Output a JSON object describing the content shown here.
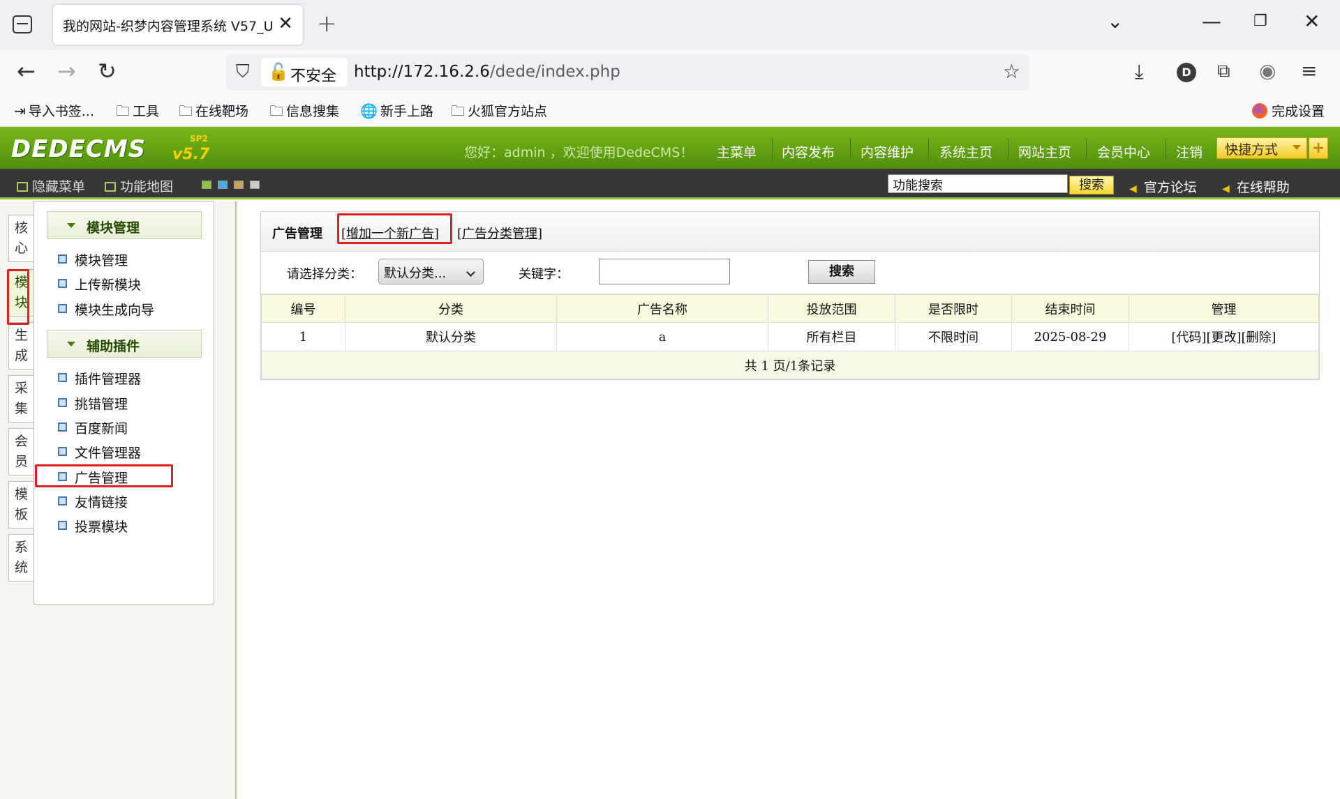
{
  "browser": {
    "tab_title": "我的网站-织梦内容管理系统 V57_U",
    "security_label": "不安全",
    "url_host": "http://172.16.2.6",
    "url_path": "/dede/index.php",
    "profile_initial": "D",
    "bookmarks": [
      "导入书签...",
      "工具",
      "在线靶场",
      "信息搜集",
      "新手上路",
      "火狐官方站点"
    ],
    "setup_label": "完成设置"
  },
  "cms": {
    "logo": "DEDECMS",
    "version": "v5.7",
    "sp": "SP2",
    "welcome": "您好：admin ，欢迎使用DedeCMS！",
    "topnav": [
      "主菜单",
      "内容发布",
      "内容维护",
      "系统主页",
      "网站主页",
      "会员中心",
      "注销"
    ],
    "quick_label": "快捷方式",
    "quick_plus": "+",
    "bar_hide_menu": "隐藏菜单",
    "bar_sitemap": "功能地图",
    "func_search_value": "功能搜索",
    "func_search_btn": "搜索",
    "forum": "官方论坛",
    "help": "在线帮助"
  },
  "side_tabs": [
    "核心",
    "模块",
    "生成",
    "采集",
    "会员",
    "模板",
    "系统"
  ],
  "menu": {
    "group1_title": "模块管理",
    "group1_items": [
      "模块管理",
      "上传新模块",
      "模块生成向导"
    ],
    "group2_title": "辅助插件",
    "group2_items": [
      "插件管理器",
      "挑错管理",
      "百度新闻",
      "文件管理器",
      "广告管理",
      "友情链接",
      "投票模块"
    ]
  },
  "main": {
    "title": "广告管理",
    "link_add": "增加一个新广告",
    "link_category": "广告分类管理",
    "filter_label": "请选择分类：",
    "filter_value": "默认分类...",
    "keyword_label": "关键字：",
    "search_btn": "搜索",
    "columns": [
      "编号",
      "分类",
      "广告名称",
      "投放范围",
      "是否限时",
      "结束时间",
      "管理"
    ],
    "rows": [
      {
        "id": "1",
        "category": "默认分类",
        "name": "a",
        "scope": "所有栏目",
        "timed": "不限时间",
        "end": "2025-08-29",
        "actions": [
          "[代码]",
          "[更改]",
          "[删除]"
        ]
      }
    ],
    "pagination": "共 1 页/1条记录"
  }
}
